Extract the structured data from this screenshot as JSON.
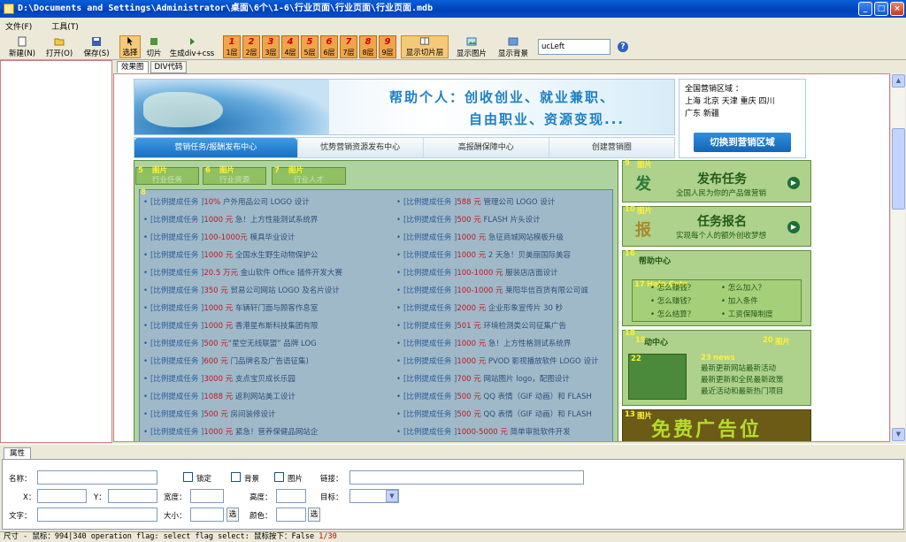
{
  "window": {
    "title": "D:\\Documents and Settings\\Administrator\\桌面\\6个\\1-6\\行业页面\\行业页面\\行业页面.mdb",
    "minimize": "_",
    "maximize": "□",
    "close": "×"
  },
  "menu": {
    "file": "文件(F)",
    "tools": "工具(T)"
  },
  "toolbar": {
    "new": "新建(N)",
    "open": "打开(O)",
    "save": "保存(S)",
    "select": "选择",
    "slice": "切片",
    "gen_div": "生成div+css",
    "layers": [
      {
        "num": "1",
        "label": "1层"
      },
      {
        "num": "2",
        "label": "2层"
      },
      {
        "num": "3",
        "label": "3层"
      },
      {
        "num": "4",
        "label": "4层"
      },
      {
        "num": "5",
        "label": "5层"
      },
      {
        "num": "6",
        "label": "6层"
      },
      {
        "num": "7",
        "label": "7层"
      },
      {
        "num": "8",
        "label": "8层"
      },
      {
        "num": "9",
        "label": "9层"
      }
    ],
    "show_slice_layer": "显示切片层",
    "show_image": "显示图片",
    "show_bg": "显示背景",
    "class_value": "ucLeft",
    "help": "?"
  },
  "tabs": {
    "preview": "效果图",
    "div_code": "DIV代码"
  },
  "page": {
    "slogan1": "帮助个人：创收创业、就业兼职、",
    "slogan2": "自由职业、资源变现...",
    "region": {
      "title": "全国营销区域 ：",
      "cities1": "上海  北京  天津  重庆  四川",
      "cities2": "广东  新疆",
      "switch": "切换到营销区域"
    },
    "nav": [
      "营销任务/报酬发布中心",
      "忧势营销资源发布中心",
      "高报酬保障中心",
      "创建营销圈"
    ],
    "subtabs": [
      {
        "slot": "5",
        "type": "图片",
        "text": "行业任务"
      },
      {
        "slot": "6",
        "type": "图片",
        "text": "行业资源"
      },
      {
        "slot": "7",
        "type": "图片",
        "text": "行业人才"
      }
    ],
    "list_slot": "8",
    "list_left": [
      {
        "cat": "[比例提成任务 ]",
        "price": "10%",
        "text": " 户外用品公司 LOGO 设计"
      },
      {
        "cat": "[比例提成任务 ]",
        "price": "1000 元",
        "text": " 急！上方性能测试系统界"
      },
      {
        "cat": "[比例提成任务 ]",
        "price": "100-1000元",
        "text": " 模具毕业设计"
      },
      {
        "cat": "[比例提成任务 ]",
        "price": "1000 元",
        "text": " 全国水生野生动物保护公"
      },
      {
        "cat": "[比例提成任务 ]",
        "price": "20.5 万元",
        "text": " 金山软件 Office 插件开发大赛"
      },
      {
        "cat": "[比例提成任务 ]",
        "price": "350 元",
        "text": " 贸易公司网站 LOGO 及名片设计"
      },
      {
        "cat": "[比例提成任务 ]",
        "price": "1000 元",
        "text": " 车辆轩门面与顾客作息室"
      },
      {
        "cat": "[比例提成任务 ]",
        "price": "1000 元",
        "text": " 香港星布斯科技集团有限"
      },
      {
        "cat": "[比例提成任务 ]",
        "price": "500 元",
        "text": "“星空无线联盟” 品牌 LOG"
      },
      {
        "cat": "[比例提成任务 ]",
        "price": "600 元",
        "text": " 门品牌名及广告语征集)"
      },
      {
        "cat": "[比例提成任务 ]",
        "price": "3000 元",
        "text": " 支点宝贝成长乐园"
      },
      {
        "cat": "[比例提成任务 ]",
        "price": "1088 元",
        "text": " 返利网站美工设计"
      },
      {
        "cat": "[比例提成任务 ]",
        "price": "500 元",
        "text": " 房间装修设计"
      },
      {
        "cat": "[比例提成任务 ]",
        "price": "1000 元",
        "text": " 紧急！营养保健品网站企"
      }
    ],
    "list_right": [
      {
        "cat": "[比例提成任务 ]",
        "price": "588 元",
        "text": " 管理公司 LOGO 设计"
      },
      {
        "cat": "[比例提成任务 ]",
        "price": "500 元",
        "text": " FLASH 片头设计"
      },
      {
        "cat": "[比例提成任务 ]",
        "price": "1000 元",
        "text": " 急征商城网站模板升级"
      },
      {
        "cat": "[比例提成任务 ]",
        "price": "1000 元",
        "text": " 2 天急！贝美丽国际美容"
      },
      {
        "cat": "[比例提成任务 ]",
        "price": "100-1000 元",
        "text": " 服装店店面设计"
      },
      {
        "cat": "[比例提成任务 ]",
        "price": "100-1000 元",
        "text": " 莱阳华信百货有限公司诚"
      },
      {
        "cat": "[比例提成任务 ]",
        "price": "2000 元",
        "text": " 企业形象宣传片 30 秒"
      },
      {
        "cat": "[比例提成任务 ]",
        "price": "501 元",
        "text": " 环境检测类公司征集广告"
      },
      {
        "cat": "[比例提成任务 ]",
        "price": "1000 元",
        "text": " 急！上方性格测试系统界"
      },
      {
        "cat": "[比例提成任务 ]",
        "price": "1000 元",
        "text": " PVOD 影视播放软件 LOGO 设计"
      },
      {
        "cat": "[比例提成任务 ]",
        "price": "700 元",
        "text": " 网站图片 logo，配图设计"
      },
      {
        "cat": "[比例提成任务 ]",
        "price": "500 元",
        "text": " QQ 表情（GIF 动画）和 FLASH"
      },
      {
        "cat": "[比例提成任务 ]",
        "price": "500 元",
        "text": " QQ 表情（GIF 动画）和 FLASH"
      },
      {
        "cat": "[比例提成任务 ]",
        "price": "1000-5000 元",
        "text": " 简单审批软件开发"
      }
    ],
    "right": {
      "publish": {
        "slot": "9",
        "type": "图片",
        "icon": "发",
        "title": "发布任务",
        "sub": "全国人民为你的产品做营销",
        "go": "▶"
      },
      "signup": {
        "slot": "10",
        "type": "图片",
        "icon": "报",
        "title": "任务报名",
        "sub": "实现每个人的额外创收梦想",
        "go": "▶"
      },
      "help": {
        "slot": "16",
        "title": "帮助中心",
        "inner_slot": "17",
        "inner_type": "Help Cats",
        "q1": "• 怎么赚钱？",
        "q2": "• 怎么加入？",
        "q3": "• 怎么赚钱？",
        "q4": "• 加入条件",
        "q5": "• 怎么结算？",
        "q6": "• 工资保障制度"
      },
      "activity": {
        "slot": "18",
        "slot19": "19",
        "title": "动中心",
        "slot20": "20",
        "type20": "图片",
        "slot22": "22",
        "slot23": "23",
        "type23": "news",
        "line1": "最新更新网站最新活动",
        "line2": "最新更新和全民最新政策",
        "line3": "最近活动和最新热门项目"
      },
      "ad": {
        "slot": "13",
        "type": "图片",
        "text": "免费广告位"
      }
    }
  },
  "properties": {
    "tab": "属性",
    "name_label": "名称：",
    "lock_label": "锁定",
    "bg_label": "背景",
    "img_label": "图片",
    "link_label": "链接：",
    "x_label": "X：",
    "y_label": "Y：",
    "width_label": "宽度：",
    "height_label": "高度：",
    "target_label": "目标：",
    "text_label": "文字：",
    "size_label": "大小：",
    "color_label": "颜色：",
    "choose": "选"
  },
  "status": {
    "text": "尺寸 - 鼠标：994|340 operation flag: select flag select: 鼠标按下：False",
    "page": "1/30"
  }
}
